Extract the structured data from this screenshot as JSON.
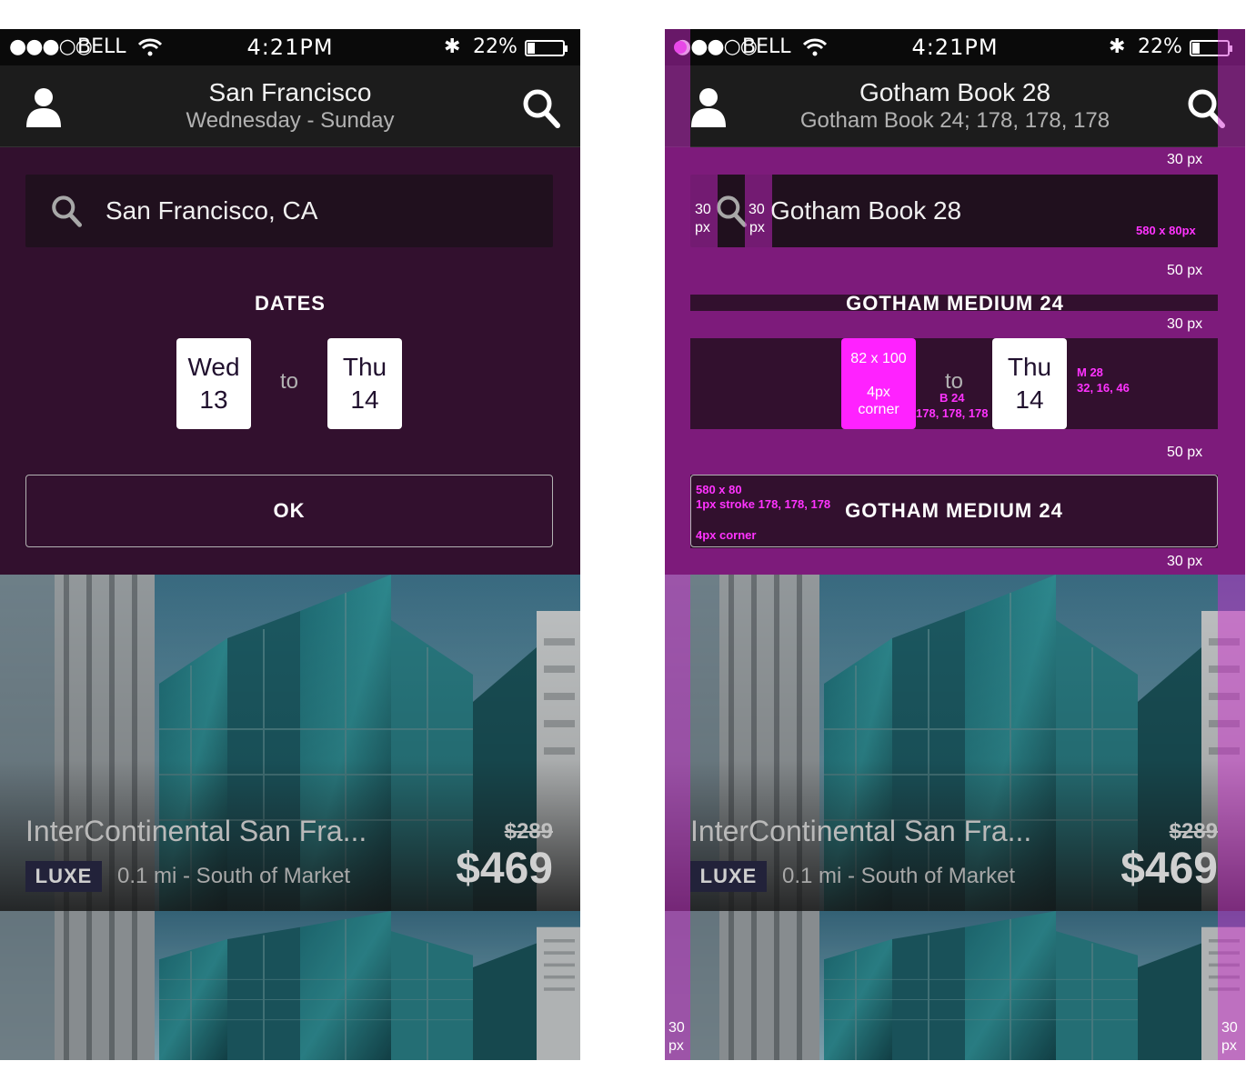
{
  "colors": {
    "panel_purple": "#32102e",
    "field_dark": "#20101e",
    "nav_dark": "#1c1c1c",
    "annotation_magenta": "#cc22cc",
    "annotation_pink": "#ff33ff"
  },
  "left_phone": {
    "status": {
      "signal": "●●●○○",
      "carrier": "BELL",
      "time": "4:21PM",
      "battery": "22%"
    },
    "nav": {
      "title": "San Francisco",
      "subtitle": "Wednesday - Sunday",
      "left_icon": "profile-icon",
      "right_icon": "search-icon"
    },
    "search": {
      "value": "San Francisco, CA",
      "icon": "search-icon"
    },
    "dates": {
      "label": "DATES",
      "from_day": "Wed",
      "from_date": "13",
      "separator": "to",
      "to_day": "Thu",
      "to_date": "14"
    },
    "ok_label": "OK",
    "hotel": {
      "name": "InterContinental San Fra...",
      "old_price": "$289",
      "price": "$469",
      "badge": "LUXE",
      "meta": "0.1 mi - South of Market"
    }
  },
  "right_phone": {
    "status": {
      "signal": "●●●○○",
      "carrier": "BELL",
      "time": "4:21PM",
      "battery": "22%"
    },
    "nav": {
      "title": "Gotham Book 28",
      "subtitle": "Gotham Book 24; 178, 178, 178"
    },
    "search_value": "Gotham Book 28",
    "dates_label": "GOTHAM MEDIUM 24",
    "box_spec_1": "82 x 100",
    "box_spec_2": "4px",
    "box_spec_3": "corner",
    "to_day": "Thu",
    "to_date": "14",
    "separator": "to",
    "sep_spec_1": "B 24",
    "sep_spec_2": "178, 178, 178",
    "date_spec_1": "M 28",
    "date_spec_2": "32, 16, 46",
    "ok_label": "GOTHAM MEDIUM 24",
    "ok_spec_1": "580 x 80",
    "ok_spec_2": "1px stroke 178, 178, 178",
    "ok_spec_3": "4px corner",
    "field_spec": "580 x 80px",
    "spacing_30_a": "30 px",
    "spacing_50_a": "50 px",
    "spacing_30_b": "30 px",
    "spacing_50_b": "50 px",
    "spacing_30_c": "30 px",
    "pad_left_top": "30",
    "pad_left_bottom": "px",
    "pad_mid_top": "30",
    "pad_mid_bottom": "px",
    "margin_left_top": "30",
    "margin_left_bottom": "px",
    "margin_right_top": "30",
    "margin_right_bottom": "px",
    "hotel": {
      "name": "InterContinental San Fra...",
      "old_price": "$289",
      "price": "$469",
      "badge": "LUXE",
      "meta": "0.1 mi - South of Market"
    }
  }
}
